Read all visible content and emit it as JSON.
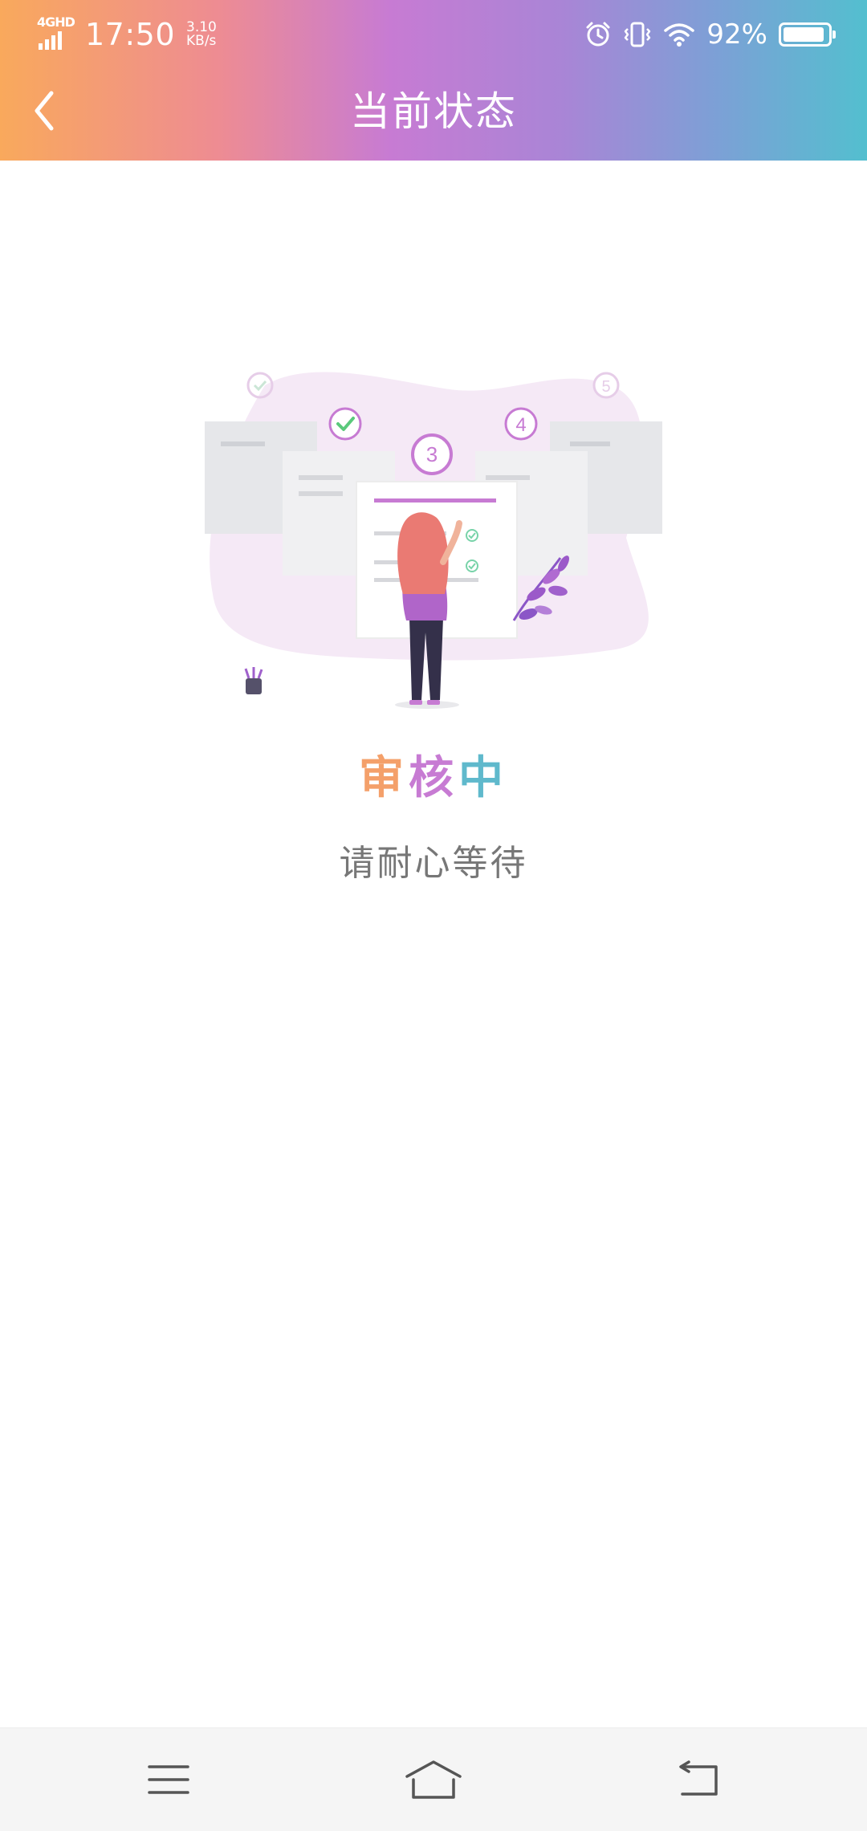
{
  "status_bar": {
    "network": "4GHD",
    "time": "17:50",
    "speed_value": "3.10",
    "speed_unit": "KB/s",
    "battery_percent": "92%",
    "battery_level": 0.92,
    "icons": [
      "alarm-icon",
      "vibrate-icon",
      "wifi-icon",
      "battery-icon"
    ]
  },
  "header": {
    "title": "当前状态",
    "back_icon": "chevron-left-icon"
  },
  "main": {
    "status_chars": [
      "审",
      "核",
      "中"
    ],
    "status_colors": [
      "#f4a06a",
      "#c77bd3",
      "#5fb9cc"
    ],
    "subtitle": "请耐心等待",
    "illustration": {
      "step_numbers": [
        "3",
        "4",
        "5"
      ]
    }
  },
  "nav_bar": {
    "icons": [
      "menu-icon",
      "home-icon",
      "back-icon"
    ]
  },
  "colors": {
    "header_gradient": [
      "#f9a95c",
      "#ee8c92",
      "#c77bd3",
      "#a985d6",
      "#7e9fd6",
      "#53bfcf"
    ],
    "accent_purple": "#c77bd3"
  }
}
